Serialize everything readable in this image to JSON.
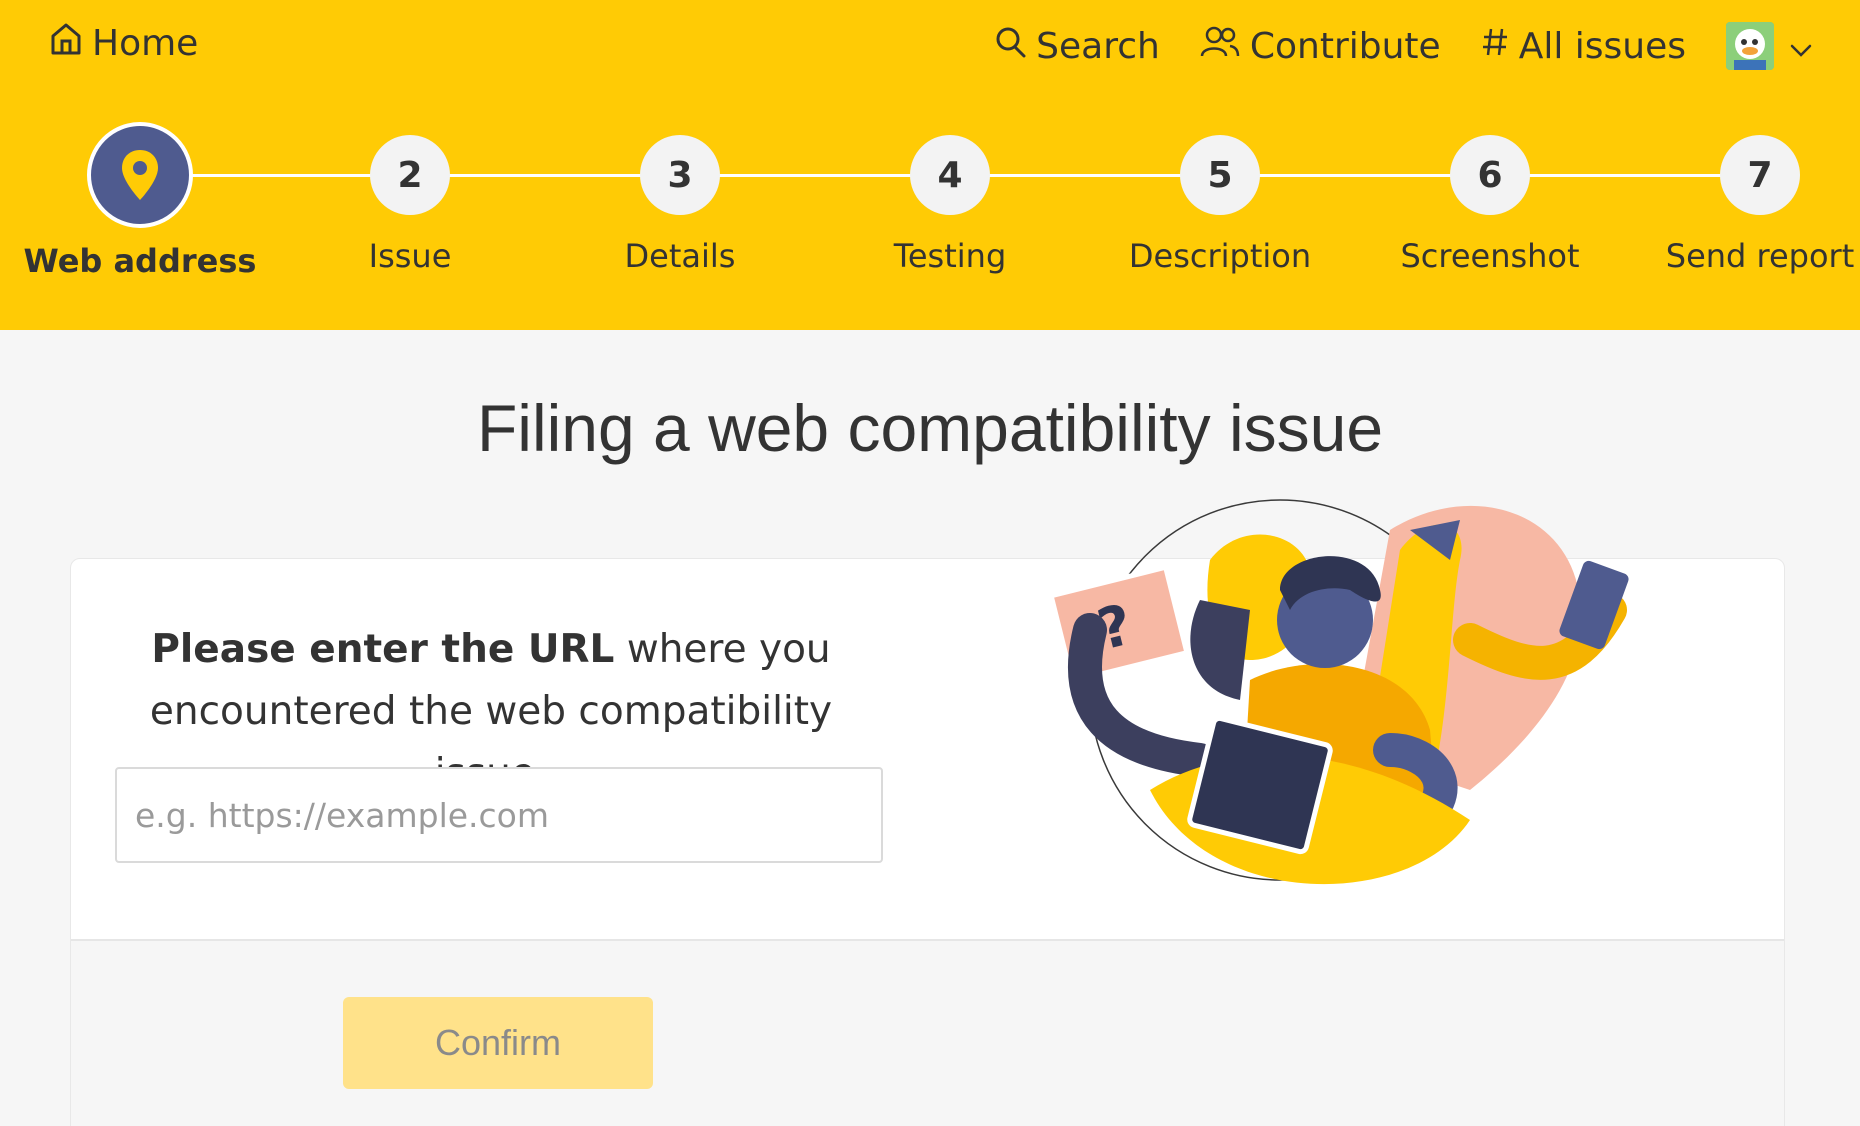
{
  "nav": {
    "home": "Home",
    "search": "Search",
    "contribute": "Contribute",
    "all_issues": "All issues"
  },
  "steps": [
    {
      "number": "",
      "label": "Web address",
      "active": true
    },
    {
      "number": "2",
      "label": "Issue"
    },
    {
      "number": "3",
      "label": "Details"
    },
    {
      "number": "4",
      "label": "Testing"
    },
    {
      "number": "5",
      "label": "Description"
    },
    {
      "number": "6",
      "label": "Screenshot"
    },
    {
      "number": "7",
      "label": "Send report"
    }
  ],
  "page": {
    "title": "Filing a web compatibility issue"
  },
  "form": {
    "instruction_bold": "Please enter the URL",
    "instruction_rest": " where you encountered the web compatibility issue.",
    "url_value": "",
    "url_placeholder": "e.g. https://example.com",
    "confirm_label": "Confirm"
  },
  "colors": {
    "header": "#ffcb05",
    "active_step": "#4f5b8f",
    "confirm_disabled": "#ffe28a"
  },
  "icons": {
    "home": "home-icon",
    "search": "search-icon",
    "contribute": "people-icon",
    "all_issues": "hash-icon",
    "step1": "location-pin-icon",
    "dropdown": "chevron-down-icon"
  }
}
